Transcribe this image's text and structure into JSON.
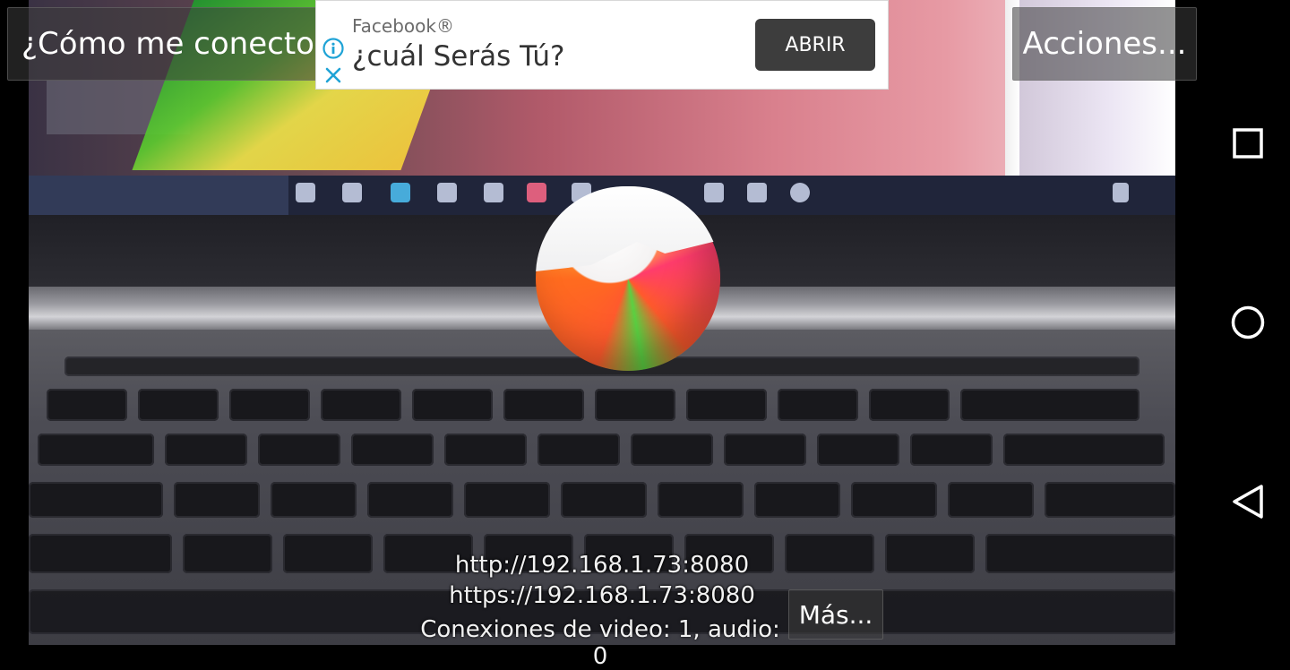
{
  "overlay": {
    "connect_label": "¿Cómo me conecto?",
    "actions_label": "Acciones...",
    "more_label": "Más..."
  },
  "ad": {
    "brand": "Facebook®",
    "title": "¿cuál Serás Tú?",
    "cta_label": "ABRIR",
    "icons": [
      "info-icon",
      "close-icon"
    ]
  },
  "server": {
    "http_url": "http://192.168.1.73:8080",
    "https_url": "https://192.168.1.73:8080",
    "connections": "Conexiones de video: 1, audio: 0"
  },
  "navbar": {
    "icons": [
      "recent-apps-icon",
      "home-icon",
      "back-icon"
    ]
  },
  "colors": {
    "overlay_bg": "#3c3c3c",
    "ad_cta_bg": "#3d3d3d",
    "ad_icon_color": "#1fa3d6"
  }
}
